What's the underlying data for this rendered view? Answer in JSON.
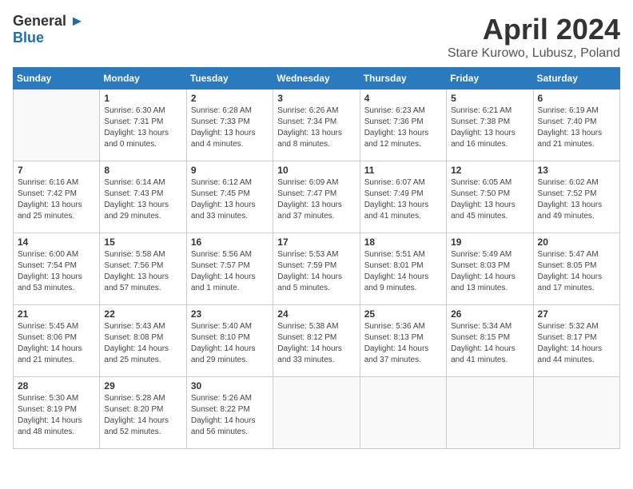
{
  "header": {
    "logo": {
      "general": "General",
      "blue": "Blue"
    },
    "title": "April 2024",
    "location": "Stare Kurowo, Lubusz, Poland"
  },
  "columns": [
    "Sunday",
    "Monday",
    "Tuesday",
    "Wednesday",
    "Thursday",
    "Friday",
    "Saturday"
  ],
  "weeks": [
    [
      {
        "day": "",
        "info": ""
      },
      {
        "day": "1",
        "info": "Sunrise: 6:30 AM\nSunset: 7:31 PM\nDaylight: 13 hours\nand 0 minutes."
      },
      {
        "day": "2",
        "info": "Sunrise: 6:28 AM\nSunset: 7:33 PM\nDaylight: 13 hours\nand 4 minutes."
      },
      {
        "day": "3",
        "info": "Sunrise: 6:26 AM\nSunset: 7:34 PM\nDaylight: 13 hours\nand 8 minutes."
      },
      {
        "day": "4",
        "info": "Sunrise: 6:23 AM\nSunset: 7:36 PM\nDaylight: 13 hours\nand 12 minutes."
      },
      {
        "day": "5",
        "info": "Sunrise: 6:21 AM\nSunset: 7:38 PM\nDaylight: 13 hours\nand 16 minutes."
      },
      {
        "day": "6",
        "info": "Sunrise: 6:19 AM\nSunset: 7:40 PM\nDaylight: 13 hours\nand 21 minutes."
      }
    ],
    [
      {
        "day": "7",
        "info": "Sunrise: 6:16 AM\nSunset: 7:42 PM\nDaylight: 13 hours\nand 25 minutes."
      },
      {
        "day": "8",
        "info": "Sunrise: 6:14 AM\nSunset: 7:43 PM\nDaylight: 13 hours\nand 29 minutes."
      },
      {
        "day": "9",
        "info": "Sunrise: 6:12 AM\nSunset: 7:45 PM\nDaylight: 13 hours\nand 33 minutes."
      },
      {
        "day": "10",
        "info": "Sunrise: 6:09 AM\nSunset: 7:47 PM\nDaylight: 13 hours\nand 37 minutes."
      },
      {
        "day": "11",
        "info": "Sunrise: 6:07 AM\nSunset: 7:49 PM\nDaylight: 13 hours\nand 41 minutes."
      },
      {
        "day": "12",
        "info": "Sunrise: 6:05 AM\nSunset: 7:50 PM\nDaylight: 13 hours\nand 45 minutes."
      },
      {
        "day": "13",
        "info": "Sunrise: 6:02 AM\nSunset: 7:52 PM\nDaylight: 13 hours\nand 49 minutes."
      }
    ],
    [
      {
        "day": "14",
        "info": "Sunrise: 6:00 AM\nSunset: 7:54 PM\nDaylight: 13 hours\nand 53 minutes."
      },
      {
        "day": "15",
        "info": "Sunrise: 5:58 AM\nSunset: 7:56 PM\nDaylight: 13 hours\nand 57 minutes."
      },
      {
        "day": "16",
        "info": "Sunrise: 5:56 AM\nSunset: 7:57 PM\nDaylight: 14 hours\nand 1 minute."
      },
      {
        "day": "17",
        "info": "Sunrise: 5:53 AM\nSunset: 7:59 PM\nDaylight: 14 hours\nand 5 minutes."
      },
      {
        "day": "18",
        "info": "Sunrise: 5:51 AM\nSunset: 8:01 PM\nDaylight: 14 hours\nand 9 minutes."
      },
      {
        "day": "19",
        "info": "Sunrise: 5:49 AM\nSunset: 8:03 PM\nDaylight: 14 hours\nand 13 minutes."
      },
      {
        "day": "20",
        "info": "Sunrise: 5:47 AM\nSunset: 8:05 PM\nDaylight: 14 hours\nand 17 minutes."
      }
    ],
    [
      {
        "day": "21",
        "info": "Sunrise: 5:45 AM\nSunset: 8:06 PM\nDaylight: 14 hours\nand 21 minutes."
      },
      {
        "day": "22",
        "info": "Sunrise: 5:43 AM\nSunset: 8:08 PM\nDaylight: 14 hours\nand 25 minutes."
      },
      {
        "day": "23",
        "info": "Sunrise: 5:40 AM\nSunset: 8:10 PM\nDaylight: 14 hours\nand 29 minutes."
      },
      {
        "day": "24",
        "info": "Sunrise: 5:38 AM\nSunset: 8:12 PM\nDaylight: 14 hours\nand 33 minutes."
      },
      {
        "day": "25",
        "info": "Sunrise: 5:36 AM\nSunset: 8:13 PM\nDaylight: 14 hours\nand 37 minutes."
      },
      {
        "day": "26",
        "info": "Sunrise: 5:34 AM\nSunset: 8:15 PM\nDaylight: 14 hours\nand 41 minutes."
      },
      {
        "day": "27",
        "info": "Sunrise: 5:32 AM\nSunset: 8:17 PM\nDaylight: 14 hours\nand 44 minutes."
      }
    ],
    [
      {
        "day": "28",
        "info": "Sunrise: 5:30 AM\nSunset: 8:19 PM\nDaylight: 14 hours\nand 48 minutes."
      },
      {
        "day": "29",
        "info": "Sunrise: 5:28 AM\nSunset: 8:20 PM\nDaylight: 14 hours\nand 52 minutes."
      },
      {
        "day": "30",
        "info": "Sunrise: 5:26 AM\nSunset: 8:22 PM\nDaylight: 14 hours\nand 56 minutes."
      },
      {
        "day": "",
        "info": ""
      },
      {
        "day": "",
        "info": ""
      },
      {
        "day": "",
        "info": ""
      },
      {
        "day": "",
        "info": ""
      }
    ]
  ]
}
